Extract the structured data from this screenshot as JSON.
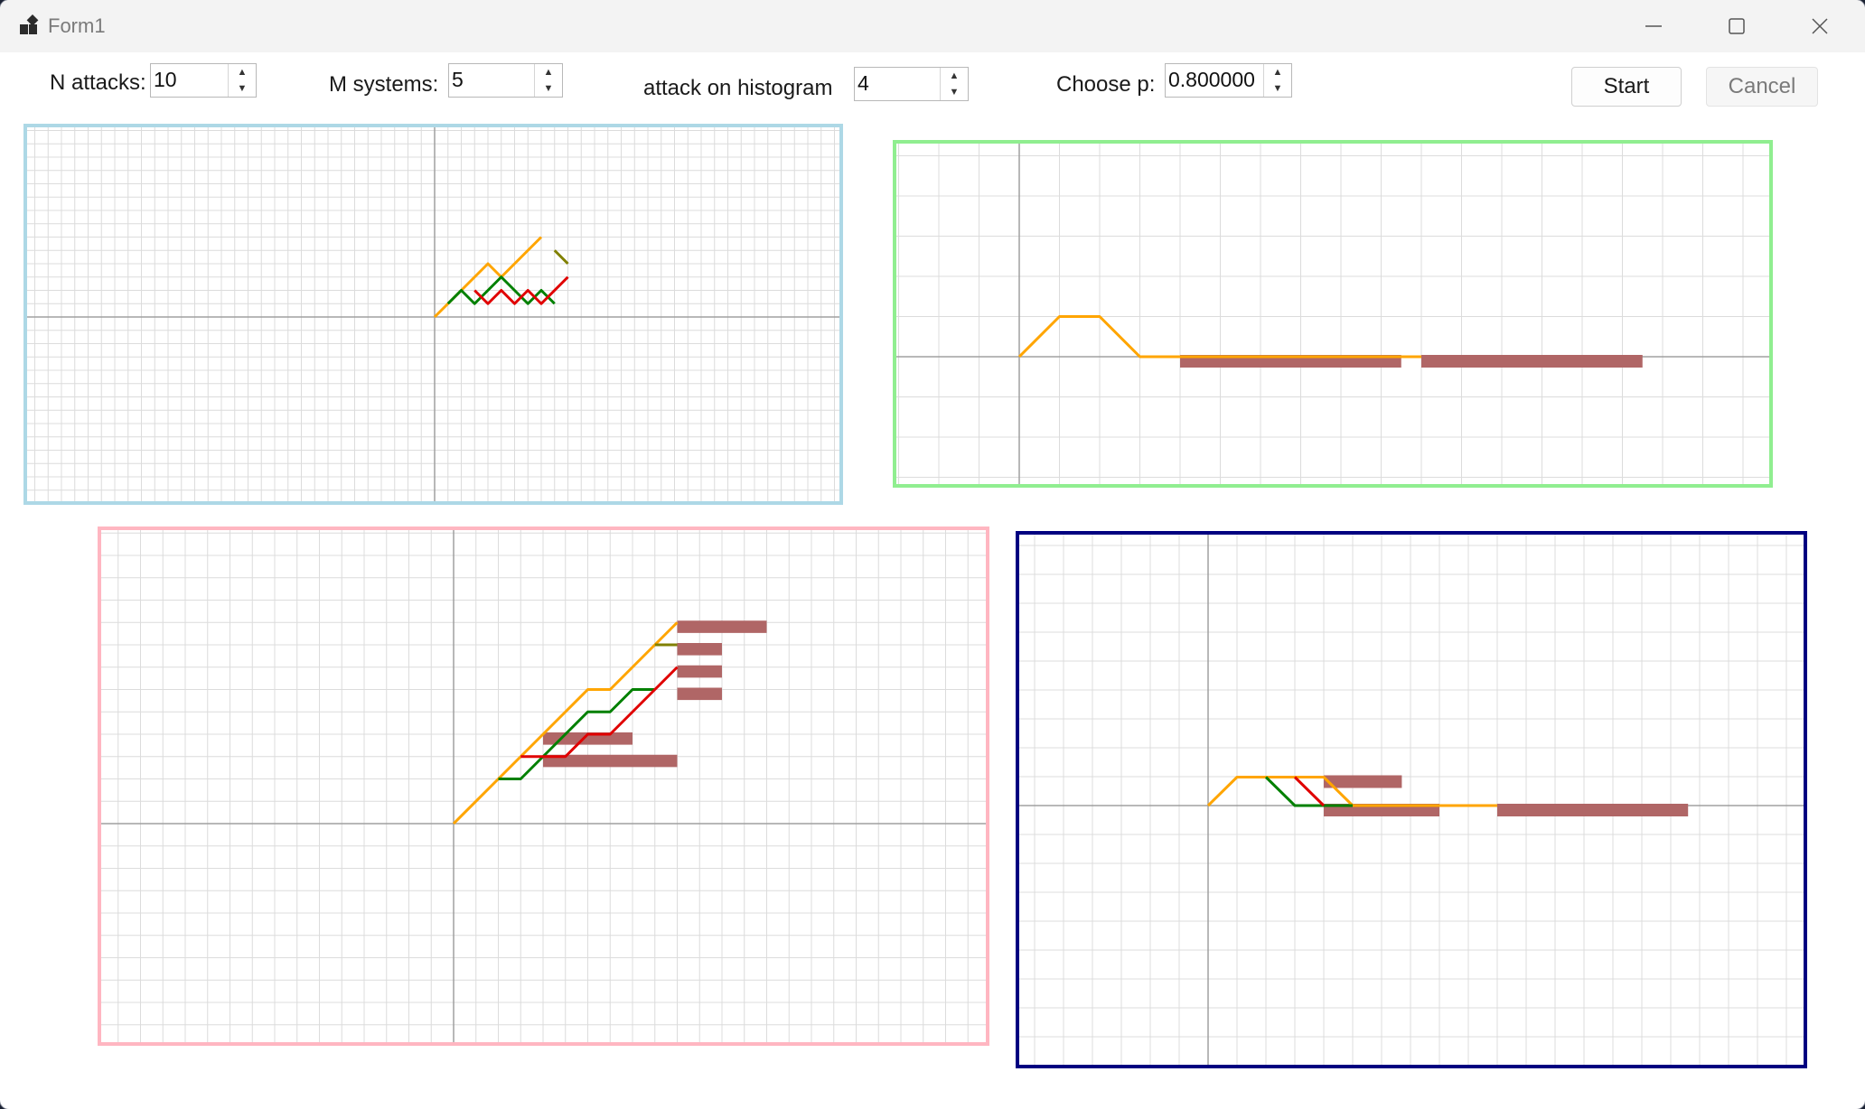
{
  "window": {
    "title": "Form1"
  },
  "controls": {
    "n_attacks": {
      "label": "N attacks:",
      "value": "10"
    },
    "m_systems": {
      "label": "M systems:",
      "value": "5"
    },
    "attack_hist": {
      "label": "attack on histogram",
      "value": "4"
    },
    "choose_p": {
      "label": "Choose p:",
      "value": "0.800000"
    },
    "start_label": "Start",
    "cancel_label": "Cancel"
  },
  "colors": {
    "orange": "#ffa500",
    "green": "#008000",
    "red": "#e00000",
    "olive": "#808000",
    "histogram": "#b06666",
    "grid": "#dcdcdc",
    "axis": "#a0a0a0",
    "panel_borders": [
      "#add8e6",
      "#90ee90",
      "#ffb6c1",
      "#000080"
    ]
  },
  "panels": [
    {
      "id": "p1",
      "border": "#add8e6",
      "series": [
        {
          "color": "#ffa500",
          "points": [
            [
              0,
              0
            ],
            [
              1,
              1
            ],
            [
              2,
              2
            ],
            [
              3,
              3
            ],
            [
              4,
              4
            ],
            [
              5,
              3
            ],
            [
              6,
              4
            ],
            [
              7,
              5
            ],
            [
              8,
              6
            ]
          ]
        },
        {
          "color": "#008000",
          "points": [
            [
              1,
              1
            ],
            [
              2,
              2
            ],
            [
              3,
              1
            ],
            [
              4,
              2
            ],
            [
              5,
              3
            ],
            [
              6,
              2
            ],
            [
              7,
              1
            ],
            [
              8,
              2
            ],
            [
              9,
              1
            ]
          ]
        },
        {
          "color": "#e00000",
          "points": [
            [
              3,
              2
            ],
            [
              4,
              1
            ],
            [
              5,
              2
            ],
            [
              6,
              1
            ],
            [
              7,
              2
            ],
            [
              8,
              1
            ],
            [
              9,
              2
            ],
            [
              10,
              3
            ]
          ]
        },
        {
          "color": "#808000",
          "points": [
            [
              9,
              5
            ],
            [
              10,
              4
            ]
          ]
        }
      ],
      "histogram": []
    },
    {
      "id": "p2",
      "series": [
        {
          "color": "#ffa500",
          "points": [
            [
              0,
              0
            ],
            [
              1,
              1
            ],
            [
              2,
              1
            ],
            [
              3,
              0
            ],
            [
              10,
              0
            ]
          ]
        }
      ],
      "histogram": [
        {
          "y": 0,
          "x0": 4,
          "x1": 9.5
        },
        {
          "y": 0,
          "x0": 10,
          "x1": 15.5
        }
      ]
    },
    {
      "id": "p3",
      "series": [
        {
          "color": "#ffa500",
          "points": [
            [
              0,
              0
            ],
            [
              2,
              2
            ],
            [
              3,
              3
            ],
            [
              4,
              4
            ],
            [
              5,
              5
            ],
            [
              6,
              6
            ],
            [
              7,
              6
            ],
            [
              8,
              7
            ],
            [
              9,
              8
            ],
            [
              10,
              9
            ]
          ]
        },
        {
          "color": "#008000",
          "points": [
            [
              2,
              2
            ],
            [
              3,
              2
            ],
            [
              4,
              3
            ],
            [
              5,
              4
            ],
            [
              6,
              5
            ],
            [
              7,
              5
            ],
            [
              8,
              6
            ],
            [
              9,
              6
            ]
          ]
        },
        {
          "color": "#e00000",
          "points": [
            [
              3,
              3
            ],
            [
              4,
              3
            ],
            [
              5,
              3
            ],
            [
              6,
              4
            ],
            [
              7,
              4
            ],
            [
              8,
              5
            ],
            [
              9,
              6
            ],
            [
              10,
              7
            ]
          ]
        },
        {
          "color": "#808000",
          "points": [
            [
              9,
              8
            ],
            [
              10,
              8
            ]
          ]
        }
      ],
      "histogram": [
        {
          "y": 9,
          "x0": 10,
          "x1": 14
        },
        {
          "y": 8,
          "x0": 10,
          "x1": 12
        },
        {
          "y": 7,
          "x0": 10,
          "x1": 12
        },
        {
          "y": 6,
          "x0": 10,
          "x1": 12
        },
        {
          "y": 4,
          "x0": 4,
          "x1": 8
        },
        {
          "y": 3,
          "x0": 4,
          "x1": 10
        }
      ]
    },
    {
      "id": "p4",
      "series": [
        {
          "color": "#ffa500",
          "points": [
            [
              0,
              0
            ],
            [
              1,
              1
            ],
            [
              4,
              1
            ],
            [
              5,
              0
            ],
            [
              10,
              0
            ]
          ]
        },
        {
          "color": "#008000",
          "points": [
            [
              2,
              1
            ],
            [
              3,
              0
            ],
            [
              5,
              0
            ]
          ]
        },
        {
          "color": "#e00000",
          "points": [
            [
              3,
              1
            ],
            [
              4,
              0
            ]
          ]
        }
      ],
      "histogram": [
        {
          "y": 1,
          "x0": 4,
          "x1": 6.7
        },
        {
          "y": 0,
          "x0": 4,
          "x1": 8
        },
        {
          "y": 0,
          "x0": 10,
          "x1": 16.6
        }
      ]
    }
  ]
}
